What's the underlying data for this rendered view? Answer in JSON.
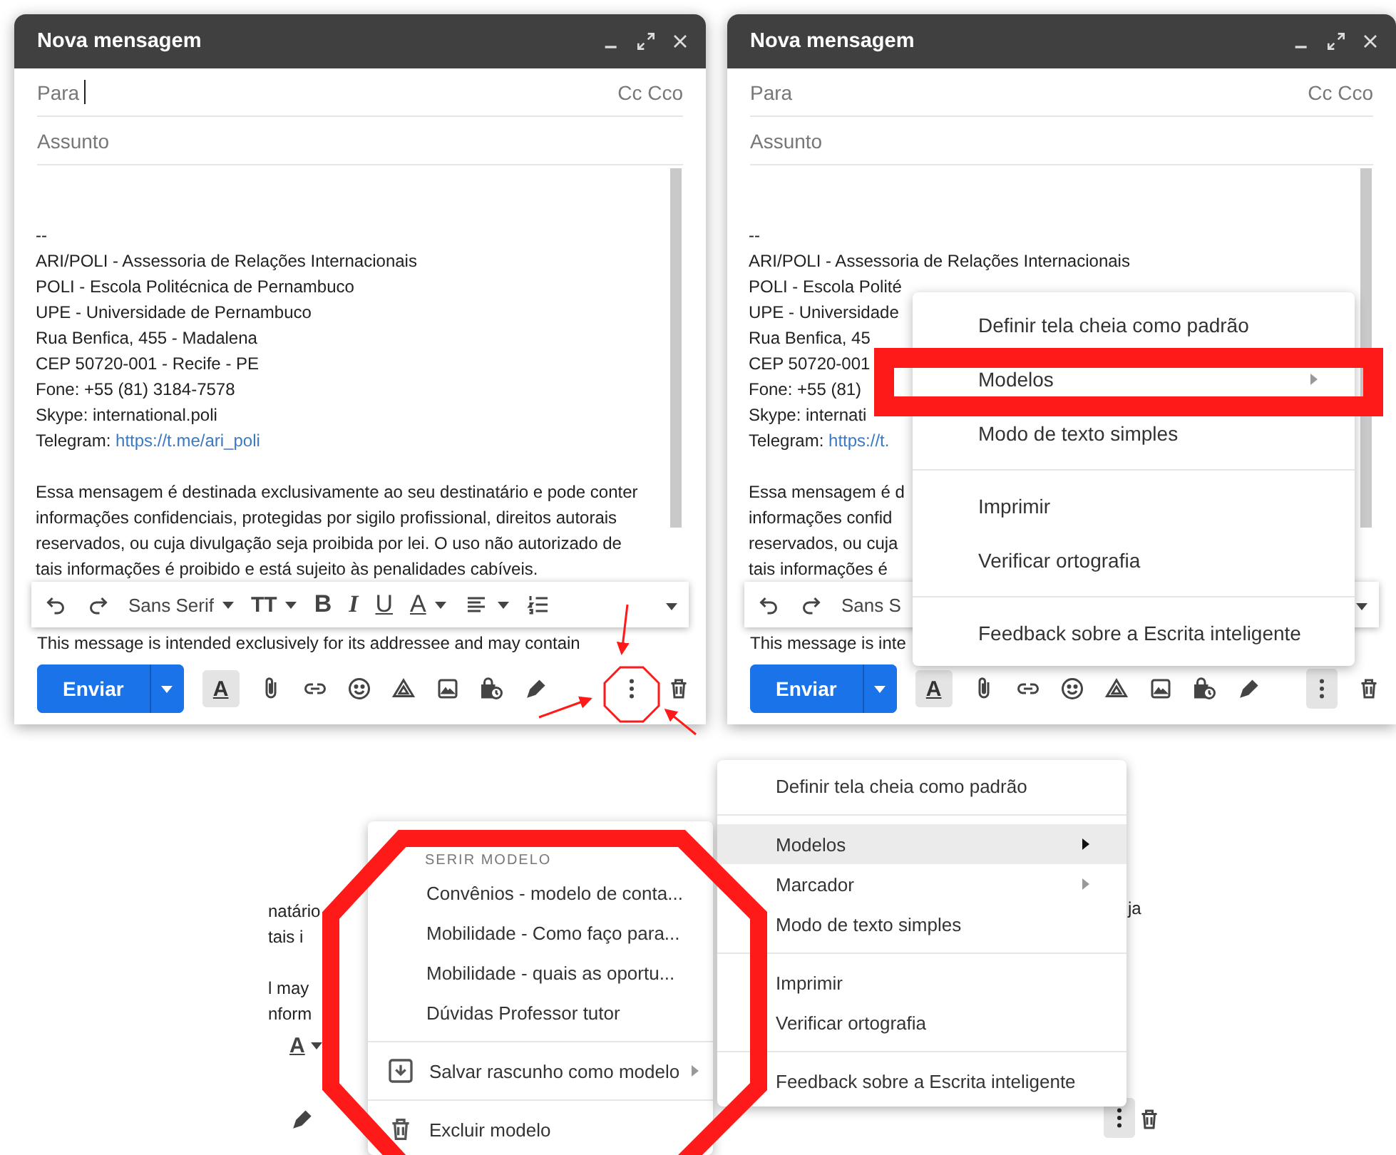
{
  "composes": [
    {
      "title": "Nova mensagem",
      "to_label": "Para",
      "to_focused": true,
      "cc_label": "Cc Cco",
      "subject_placeholder": "Assunto",
      "body": [
        {
          "kind": "line",
          "text": "--"
        },
        {
          "kind": "line",
          "text": "ARI/POLI - Assessoria de Relações Internacionais"
        },
        {
          "kind": "line",
          "text": "POLI - Escola Politécnica de Pernambuco"
        },
        {
          "kind": "line",
          "text": "UPE - Universidade de Pernambuco"
        },
        {
          "kind": "line",
          "text": "Rua Benfica, 455 - Madalena"
        },
        {
          "kind": "line",
          "text": "CEP 50720-001 - Recife - PE"
        },
        {
          "kind": "line",
          "text": "Fone: +55 (81) 3184-7578"
        },
        {
          "kind": "line",
          "text": "Skype: international.poli"
        },
        {
          "kind": "link_line",
          "text": "Telegram: ",
          "link": "https://t.me/ari_poli"
        },
        {
          "kind": "blank"
        },
        {
          "kind": "line",
          "text": "Essa mensagem é destinada exclusivamente ao seu destinatário e pode conter"
        },
        {
          "kind": "line",
          "text": "informações confidenciais, protegidas por sigilo profissional, direitos autorais"
        },
        {
          "kind": "line",
          "text": "reservados, ou cuja divulgação seja proibida por lei. O uso não autorizado de"
        },
        {
          "kind": "line",
          "text": "tais informações é proibido e está sujeito às penalidades cabíveis."
        }
      ],
      "toolbar": [
        {
          "kind": "undo"
        },
        {
          "kind": "redo"
        },
        {
          "kind": "font",
          "text": "Sans Serif",
          "caret": true
        },
        {
          "kind": "size",
          "text": "TT"
        },
        {
          "kind": "bold",
          "text": "B"
        },
        {
          "kind": "italic",
          "text": "I"
        },
        {
          "kind": "underline",
          "text": "U"
        },
        {
          "kind": "color",
          "text": "A"
        },
        {
          "kind": "align"
        },
        {
          "kind": "list"
        },
        {
          "kind": "more"
        }
      ],
      "after_toolbar": "This message is intended exclusively for its addressee and may contain",
      "send_label": "Enviar",
      "format_glyph": "A",
      "more_active": false
    },
    {
      "title": "Nova mensagem",
      "to_label": "Para",
      "to_focused": false,
      "cc_label": "Cc Cco",
      "subject_placeholder": "Assunto",
      "body": [
        {
          "kind": "line",
          "text": "--"
        },
        {
          "kind": "line",
          "text": "ARI/POLI - Assessoria de Relações Internacionais"
        },
        {
          "kind": "line",
          "text": "POLI - Escola Polité"
        },
        {
          "kind": "line",
          "text": "UPE - Universidade"
        },
        {
          "kind": "line",
          "text": "Rua Benfica, 45"
        },
        {
          "kind": "line",
          "text": "CEP 50720-001"
        },
        {
          "kind": "line",
          "text": "Fone: +55 (81)"
        },
        {
          "kind": "line",
          "text": "Skype: internati"
        },
        {
          "kind": "link_line",
          "text": "Telegram: ",
          "link": "https://t."
        },
        {
          "kind": "blank"
        },
        {
          "kind": "line",
          "text": "Essa mensagem é d"
        },
        {
          "kind": "line",
          "text": "informações confid"
        },
        {
          "kind": "line",
          "text": "reservados, ou cuja"
        },
        {
          "kind": "line",
          "text": "tais informações é"
        }
      ],
      "toolbar": [
        {
          "kind": "undo"
        },
        {
          "kind": "redo"
        },
        {
          "kind": "font",
          "text": "Sans S",
          "caret": false
        },
        {
          "kind": "more"
        }
      ],
      "after_toolbar": "This message is inte",
      "send_label": "Enviar",
      "format_glyph": "A",
      "more_active": true,
      "menu": {
        "items": [
          {
            "kind": "item",
            "label": "Definir tela cheia como padrão",
            "submenu": false,
            "selected": false
          },
          {
            "kind": "item",
            "label": "Modelos",
            "submenu": true,
            "selected": false
          },
          {
            "kind": "item",
            "label": "Modo de texto simples",
            "submenu": false,
            "selected": false
          },
          {
            "kind": "divider"
          },
          {
            "kind": "item",
            "label": "Imprimir",
            "submenu": false,
            "selected": false
          },
          {
            "kind": "item",
            "label": "Verificar ortografia",
            "submenu": false,
            "selected": false
          },
          {
            "kind": "divider"
          },
          {
            "kind": "item",
            "label": "Feedback sobre a Escrita inteligente",
            "submenu": false,
            "selected": false
          }
        ]
      }
    }
  ],
  "bottom": {
    "fragments": [
      "natário",
      "tais i",
      "l may",
      "nform"
    ],
    "right_fragment": "ja",
    "format_glyph": "A",
    "submenu": {
      "header": "SERIR MODELO",
      "items": [
        {
          "kind": "template",
          "label": "Convênios - modelo de conta...",
          "selected": false
        },
        {
          "kind": "template",
          "label": "Mobilidade - Como faço para...",
          "selected": false
        },
        {
          "kind": "template",
          "label": "Mobilidade - quais as oportu...",
          "selected": false
        },
        {
          "kind": "template",
          "label": "Dúvidas Professor tutor",
          "selected": false
        },
        {
          "kind": "divider"
        },
        {
          "kind": "save_action",
          "label": "Salvar rascunho como modelo",
          "submenu": true,
          "selected": false
        },
        {
          "kind": "divider"
        },
        {
          "kind": "delete_action",
          "label": "Excluir modelo",
          "submenu": false,
          "selected": false
        }
      ]
    },
    "menu": {
      "items": [
        {
          "kind": "item",
          "label": "Definir tela cheia como padrão",
          "submenu": false,
          "selected": false
        },
        {
          "kind": "divider"
        },
        {
          "kind": "item",
          "label": "Modelos",
          "submenu": true,
          "selected": true
        },
        {
          "kind": "item",
          "label": "Marcador",
          "submenu": true,
          "selected": false
        },
        {
          "kind": "item",
          "label": "Modo de texto simples",
          "submenu": false,
          "selected": false
        },
        {
          "kind": "divider"
        },
        {
          "kind": "item",
          "label": "Imprimir",
          "submenu": false,
          "selected": false
        },
        {
          "kind": "item",
          "label": "Verificar ortografia",
          "submenu": false,
          "selected": false
        },
        {
          "kind": "divider"
        },
        {
          "kind": "item",
          "label": "Feedback sobre a Escrita inteligente",
          "submenu": false,
          "selected": false
        }
      ]
    }
  }
}
